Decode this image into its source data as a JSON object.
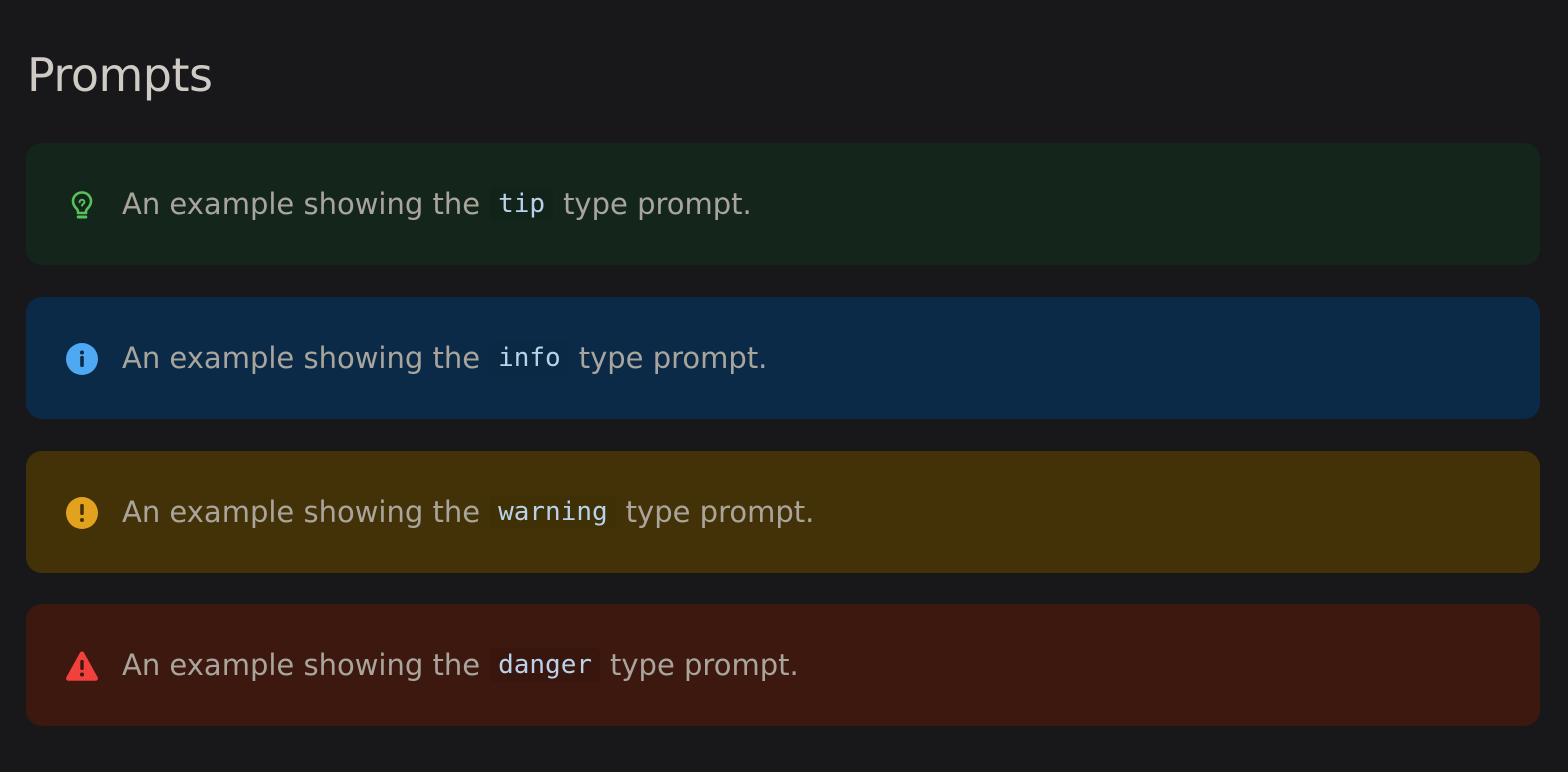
{
  "page": {
    "title": "Prompts"
  },
  "prompts": [
    {
      "type": "tip",
      "icon": "lightbulb-icon",
      "icon_color": "#57c25a",
      "background": "#14261c",
      "text_before": "An example showing the",
      "code": "tip",
      "text_after": "type prompt."
    },
    {
      "type": "info",
      "icon": "info-circle-icon",
      "icon_color": "#4ea8f2",
      "background": "#0a2a48",
      "text_before": "An example showing the",
      "code": "info",
      "text_after": "type prompt."
    },
    {
      "type": "warning",
      "icon": "exclamation-circle-icon",
      "icon_color": "#e3a21e",
      "background": "#433207",
      "text_before": "An example showing the",
      "code": "warning",
      "text_after": "type prompt."
    },
    {
      "type": "danger",
      "icon": "warning-triangle-icon",
      "icon_color": "#f0413c",
      "background": "#3c180e",
      "text_before": "An example showing the",
      "code": "danger",
      "text_after": "type prompt."
    }
  ]
}
